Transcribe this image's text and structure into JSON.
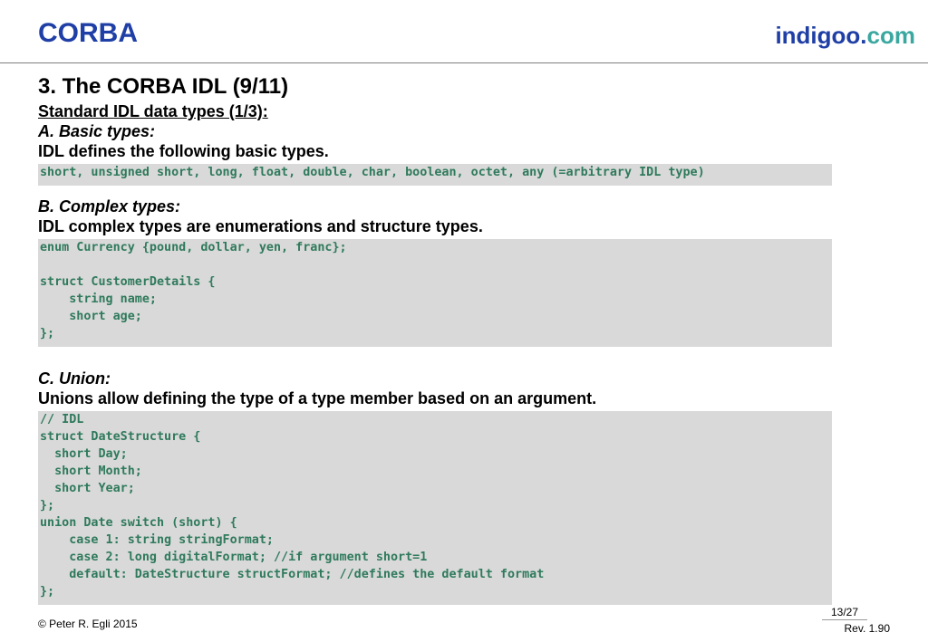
{
  "header": {
    "left_title": "CORBA",
    "brand_main": "indigoo.",
    "brand_suffix": "com"
  },
  "slide": {
    "title": "3. The CORBA IDL (9/11)",
    "subtitle": "Standard IDL data types (1/3):",
    "sections": [
      {
        "heading": "A. Basic types:",
        "text": "IDL defines the following basic types.",
        "code": [
          "short, unsigned short, long, float, double, char, boolean, octet, any (=arbitrary IDL type)"
        ]
      },
      {
        "heading": "B. Complex types:",
        "text": "IDL complex types are enumerations and structure types.",
        "code": [
          "enum Currency {pound, dollar, yen, franc};",
          "",
          "struct CustomerDetails {",
          "    string name;",
          "    short age;",
          "};"
        ]
      },
      {
        "heading": "C. Union:",
        "text": "Unions allow defining the type of a type member based on an argument.",
        "code": [
          "// IDL",
          "struct DateStructure {",
          "  short Day;",
          "  short Month;",
          "  short Year;",
          "};",
          "union Date switch (short) {",
          "    case 1: string stringFormat;",
          "    case 2: long digitalFormat; //if argument short=1",
          "    default: DateStructure structFormat; //defines the default format",
          "};"
        ]
      }
    ]
  },
  "footer": {
    "copyright": "© Peter R. Egli 2015",
    "page": "13/27",
    "revision": "Rev. 1.90"
  },
  "colors": {
    "brand_blue": "#1f3fa6",
    "brand_teal": "#3aa8a0",
    "code_green": "#2f7a5c",
    "code_background": "#d9d9d9"
  }
}
